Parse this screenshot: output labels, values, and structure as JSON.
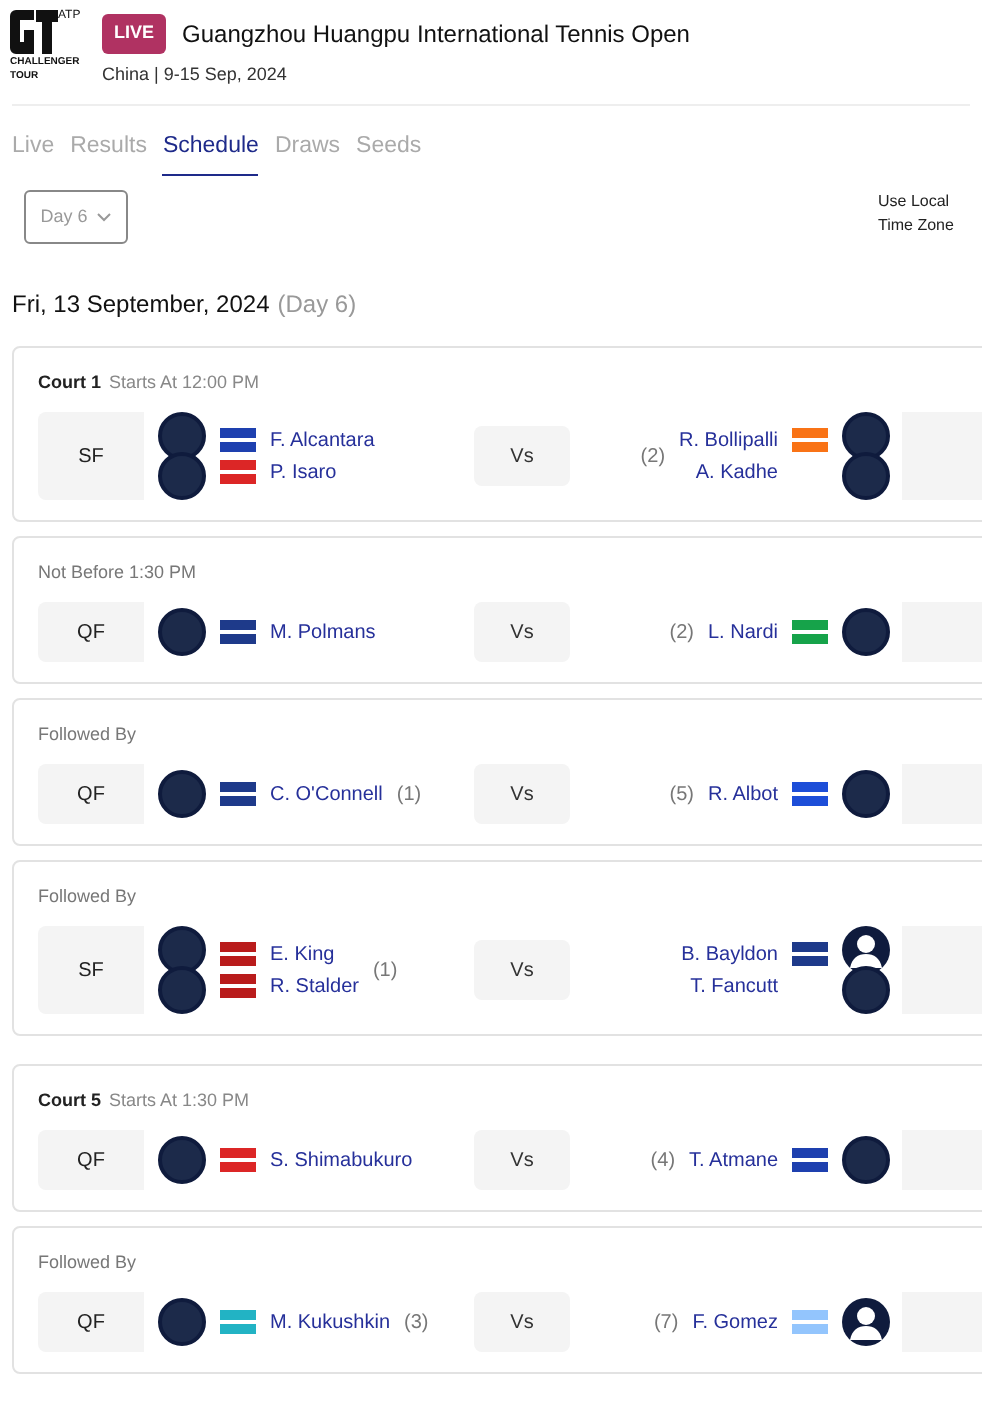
{
  "logo": {
    "mark": "ATP",
    "tagline": "CHALLENGER TOUR"
  },
  "event": {
    "badge": "LIVE",
    "title": "Guangzhou Huangpu International Tennis Open",
    "subtitle": "China | 9-15 Sep, 2024"
  },
  "tabs": [
    {
      "label": "Live",
      "selected": false
    },
    {
      "label": "Results",
      "selected": false
    },
    {
      "label": "Schedule",
      "selected": true
    },
    {
      "label": "Draws",
      "selected": false
    },
    {
      "label": "Seeds",
      "selected": false
    }
  ],
  "day_select": {
    "value": "Day 6"
  },
  "timezone_toggle": {
    "label": "Use Local Time Zone"
  },
  "date": {
    "text": "Fri, 13 September, 2024",
    "day": "(Day 6)"
  },
  "courts": [
    {
      "name": "Court 1",
      "start": "Starts At 12:00 PM",
      "matches": [
        {
          "round": "SF",
          "vs": "Vs",
          "left": {
            "players": [
              {
                "name": "F. Alcantara",
                "color": "#1e40af",
                "kind": "photo"
              },
              {
                "name": "P. Isaro",
                "color": "#dc2626",
                "kind": "photo"
              }
            ]
          },
          "right": {
            "seed": "(2)",
            "players": [
              {
                "name": "R. Bollipalli",
                "color": "#f97316",
                "kind": "photo"
              },
              {
                "name": "A. Kadhe",
                "kind": "photo"
              }
            ]
          }
        },
        {
          "heading": "Not Before 1:30 PM",
          "round": "QF",
          "vs": "Vs",
          "left": {
            "players": [
              {
                "name": "M. Polmans",
                "color": "#1e3a8a",
                "kind": "photo"
              }
            ]
          },
          "right": {
            "seed": "(2)",
            "players": [
              {
                "name": "L. Nardi",
                "color": "#16a34a",
                "kind": "photo"
              }
            ]
          }
        },
        {
          "heading": "Followed By",
          "round": "QF",
          "vs": "Vs",
          "left": {
            "seed": "(1)",
            "players": [
              {
                "name": "C. O'Connell",
                "color": "#1e3a8a",
                "kind": "photo"
              }
            ]
          },
          "right": {
            "seed": "(5)",
            "players": [
              {
                "name": "R. Albot",
                "color": "#1d4ed8",
                "kind": "photo"
              }
            ]
          }
        },
        {
          "heading": "Followed By",
          "round": "SF",
          "vs": "Vs",
          "left": {
            "seed": "(1)",
            "players": [
              {
                "name": "E. King",
                "color": "#b91c1c",
                "kind": "photo"
              },
              {
                "name": "R. Stalder",
                "color": "#b91c1c",
                "kind": "photo"
              }
            ]
          },
          "right": {
            "players": [
              {
                "name": "B. Bayldon",
                "color": "#1e3a8a",
                "kind": "silhouette"
              },
              {
                "name": "T. Fancutt",
                "kind": "photo"
              }
            ]
          }
        }
      ]
    },
    {
      "name": "Court 5",
      "start": "Starts At 1:30 PM",
      "matches": [
        {
          "round": "QF",
          "vs": "Vs",
          "left": {
            "players": [
              {
                "name": "S. Shimabukuro",
                "color": "#dc2626",
                "kind": "photo"
              }
            ]
          },
          "right": {
            "seed": "(4)",
            "players": [
              {
                "name": "T. Atmane",
                "color": "#1e40af",
                "kind": "photo"
              }
            ]
          }
        },
        {
          "heading": "Followed By",
          "round": "QF",
          "vs": "Vs",
          "left": {
            "seed": "(3)",
            "players": [
              {
                "name": "M. Kukushkin",
                "color": "#22b3c4",
                "kind": "photo"
              }
            ]
          },
          "right": {
            "seed": "(7)",
            "players": [
              {
                "name": "F. Gomez",
                "color": "#93c5fd",
                "kind": "silhouette"
              }
            ]
          }
        }
      ]
    }
  ]
}
